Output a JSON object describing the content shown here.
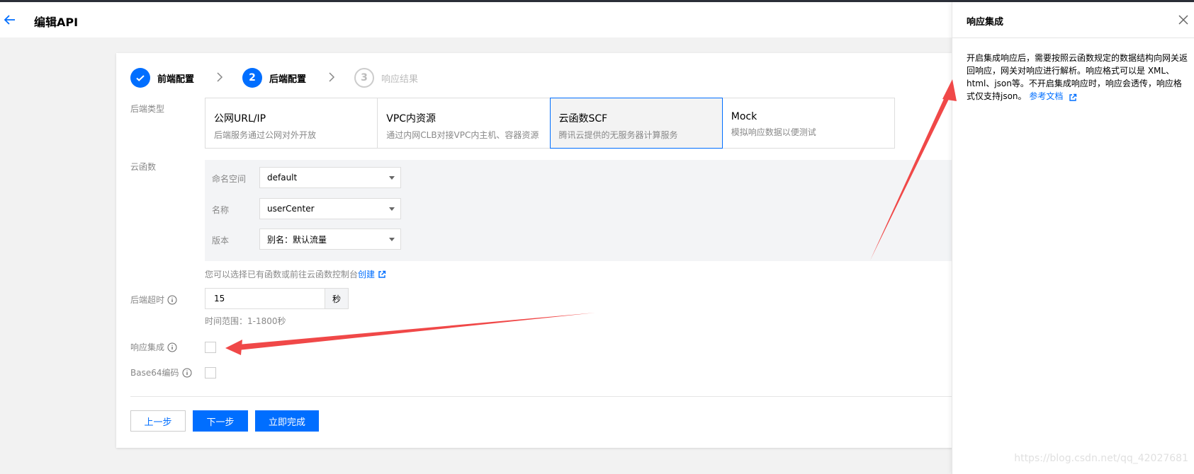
{
  "header": {
    "title": "编辑API"
  },
  "steps": [
    {
      "index": "1",
      "label": "前端配置",
      "state": "done"
    },
    {
      "index": "2",
      "label": "后端配置",
      "state": "active"
    },
    {
      "index": "3",
      "label": "响应结果",
      "state": "todo"
    }
  ],
  "form": {
    "backend_type_label": "后端类型",
    "backend_types": [
      {
        "title": "公网URL/IP",
        "desc": "后端服务通过公网对外开放"
      },
      {
        "title": "VPC内资源",
        "desc": "通过内网CLB对接VPC内主机、容器资源"
      },
      {
        "title": "云函数SCF",
        "desc": "腾讯云提供的无服务器计算服务",
        "selected": true
      },
      {
        "title": "Mock",
        "desc": "模拟响应数据以便测试"
      }
    ],
    "scf_label": "云函数",
    "namespace_label": "命名空间",
    "namespace_value": "default",
    "name_label": "名称",
    "name_value": "userCenter",
    "version_label": "版本",
    "version_value": "别名：默认流量",
    "scf_hint": "您可以选择已有函数或前往云函数控制台",
    "scf_hint_link": "创建",
    "timeout_label": "后端超时",
    "timeout_value": "15",
    "timeout_unit": "秒",
    "timeout_hint": "时间范围：1-1800秒",
    "response_integration_label": "响应集成",
    "base64_label": "Base64编码"
  },
  "buttons": {
    "prev": "上一步",
    "next": "下一步",
    "finish": "立即完成"
  },
  "drawer": {
    "title": "响应集成",
    "body": "开启集成响应后，需要按照云函数规定的数据结构向网关返回响应，网关对响应进行解析。响应格式可以是 XML、html、json等。不开启集成响应时，响应会透传，响应格式仅支持json。",
    "link": "参考文档"
  },
  "watermark": "https://blog.csdn.net/qq_42027681",
  "colors": {
    "accent": "#006eff",
    "annotation": "#f04848"
  }
}
